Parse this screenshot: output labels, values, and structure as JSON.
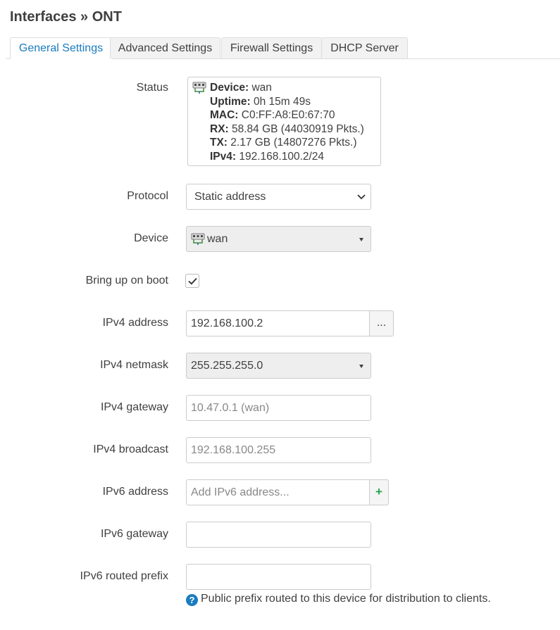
{
  "page": {
    "title": "Interfaces » ONT"
  },
  "tabs": [
    {
      "label": "General Settings",
      "active": true
    },
    {
      "label": "Advanced Settings",
      "active": false
    },
    {
      "label": "Firewall Settings",
      "active": false
    },
    {
      "label": "DHCP Server",
      "active": false
    }
  ],
  "status": {
    "label": "Status",
    "icon": "ethernet-port-icon",
    "lines": [
      {
        "key": "Device:",
        "value": " wan"
      },
      {
        "key": "Uptime:",
        "value": " 0h 15m 49s"
      },
      {
        "key": "MAC:",
        "value": " C0:FF:A8:E0:67:70"
      },
      {
        "key": "RX:",
        "value": " 58.84 GB (44030919 Pkts.)"
      },
      {
        "key": "TX:",
        "value": " 2.17 GB (14807276 Pkts.)"
      },
      {
        "key": "IPv4:",
        "value": " 192.168.100.2/24"
      }
    ]
  },
  "fields": {
    "protocol": {
      "label": "Protocol",
      "value": "Static address"
    },
    "device": {
      "label": "Device",
      "value": "wan",
      "icon": "ethernet-port-icon"
    },
    "boot": {
      "label": "Bring up on boot",
      "checked": true
    },
    "ipv4_address": {
      "label": "IPv4 address",
      "value": "192.168.100.2",
      "addon": "..."
    },
    "ipv4_netmask": {
      "label": "IPv4 netmask",
      "value": "255.255.255.0"
    },
    "ipv4_gateway": {
      "label": "IPv4 gateway",
      "placeholder": "10.47.0.1 (wan)"
    },
    "ipv4_broadcast": {
      "label": "IPv4 broadcast",
      "placeholder": "192.168.100.255"
    },
    "ipv6_address": {
      "label": "IPv6 address",
      "placeholder": "Add IPv6 address...",
      "addon": "+"
    },
    "ipv6_gateway": {
      "label": "IPv6 gateway",
      "value": ""
    },
    "ipv6_prefix": {
      "label": "IPv6 routed prefix",
      "value": "",
      "help": "Public prefix routed to this device for distribution to clients."
    }
  },
  "colors": {
    "accent": "#1a7cc0",
    "add": "#2ca24c",
    "text": "#404040"
  }
}
